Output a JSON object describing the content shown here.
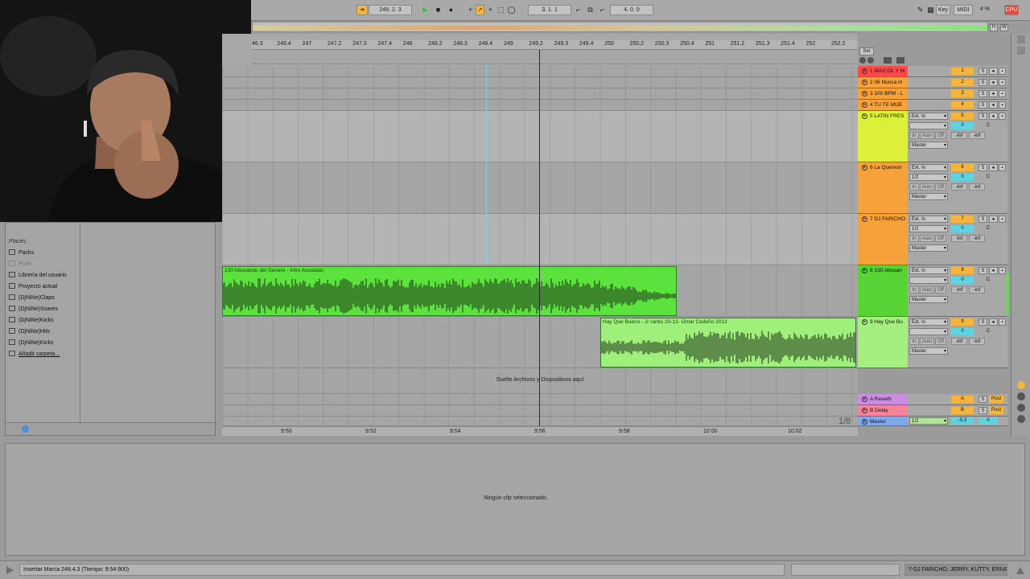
{
  "transport": {
    "follow_icon": "follow-arrow-icon",
    "song_position": "249.   2.   3",
    "loop_start": "3.   1.   1",
    "loop_length": "4.   0.   0"
  },
  "top_right": {
    "key_label": "Key",
    "midi_label": "MIDI",
    "cpu_percent": "4 %",
    "cpu_label": "CPU"
  },
  "ruler": {
    "bars": [
      "46.3",
      "246.4",
      "247",
      "247.2",
      "247.3",
      "247.4",
      "248",
      "248.2",
      "248.3",
      "248.4",
      "249",
      "249.2",
      "249.3",
      "249.4",
      "250",
      "250.2",
      "250.3",
      "250.4",
      "251",
      "251.2",
      "251.3",
      "251.4",
      "252",
      "252.2"
    ],
    "set_label": "Set"
  },
  "timeline": {
    "ticks": [
      "9:50",
      "9:52",
      "9:54",
      "9:56",
      "9:58",
      "10:00",
      "10:02"
    ],
    "quantize": "1/8"
  },
  "browser": {
    "places_header": "Places",
    "items": [
      {
        "label": "Packs",
        "icon": "packs-icon"
      },
      {
        "label": "Push",
        "icon": "push-icon"
      },
      {
        "label": "Librería del usuario",
        "icon": "folder-icon"
      },
      {
        "label": "Proyecto actual",
        "icon": "folder-icon"
      },
      {
        "label": "(DjNiNe)Claps",
        "icon": "folder-icon"
      },
      {
        "label": "(DjNiNe)Snares",
        "icon": "folder-icon"
      },
      {
        "label": "(DjNiNe)Kicks",
        "icon": "folder-icon"
      },
      {
        "label": "(DjNiNe)Hits",
        "icon": "folder-icon"
      },
      {
        "label": "(DjNiNe)Kicks",
        "icon": "folder-icon"
      },
      {
        "label": "Añadir carpeta...",
        "icon": "add-folder-icon"
      }
    ]
  },
  "tracks": [
    {
      "name": "1 MAICOL Y M",
      "color": "#ff4a4a",
      "num": "1"
    },
    {
      "name": "2 06 Nunca m",
      "color": "#f5a23a",
      "num": "2"
    },
    {
      "name": "3 100 BPM - L",
      "color": "#f5a23a",
      "num": "3"
    },
    {
      "name": "4 TU TE MUE",
      "color": "#f5a23a",
      "num": "4"
    },
    {
      "name": "5 LATIN FRES",
      "color": "#dcf038",
      "num": "5",
      "input": "Ext. In",
      "channel": "",
      "monitor": [
        "In",
        "Auto",
        "Off"
      ],
      "output": "Master",
      "vol": "-inf",
      "send": "-inf",
      "pan": "C",
      "zero": "0"
    },
    {
      "name": "6 La Quemon",
      "color": "#f5a23a",
      "num": "6",
      "input": "Ext. In",
      "channel": "1/2",
      "monitor": [
        "In",
        "Auto",
        "Off"
      ],
      "output": "Master",
      "vol": "-inf",
      "send": "-inf",
      "pan": "C",
      "zero": "0"
    },
    {
      "name": "7 DJ FARICHO",
      "color": "#f5a23a",
      "num": "7",
      "input": "Ext. In",
      "channel": "1/2",
      "monitor": [
        "In",
        "Auto",
        "Off"
      ],
      "output": "Master",
      "vol": "-inf",
      "send": "-inf",
      "pan": "C",
      "zero": "0"
    },
    {
      "name": "8 130 Abusan",
      "color": "#55d434",
      "num": "8",
      "input": "Ext. In",
      "channel": "",
      "monitor": [
        "In",
        "Auto",
        "Off"
      ],
      "output": "Master",
      "vol": "-inf",
      "send": "-inf",
      "pan": "C",
      "zero": "0"
    },
    {
      "name": "9 Hay Que Bu",
      "color": "#a4ef80",
      "num": "9",
      "input": "Ext. In",
      "channel": "",
      "monitor": [
        "In",
        "Auto",
        "Off"
      ],
      "output": "Master",
      "vol": "-inf",
      "send": "-inf",
      "pan": "C",
      "zero": "0"
    }
  ],
  "returns": [
    {
      "name": "A Reverb",
      "color": "#c98ee0",
      "num": "A",
      "post": "Post"
    },
    {
      "name": "B Delay",
      "color": "#f5849a",
      "num": "B",
      "post": "Post"
    },
    {
      "name": "Master",
      "color": "#7fa8e8",
      "num": "0",
      "channel": "1/2",
      "vol": "-5.3"
    }
  ],
  "clips": [
    {
      "title": "130 Abusando del Genero - Intro Asustado",
      "color": "#5ce23c"
    },
    {
      "title": "Hay Que Bueno - Jr ranks 20-13- Omar Cedeño 2013",
      "color": "#9ff07a"
    }
  ],
  "drop_hint": "Suelte Archivos y Dispositivos aquí",
  "detail_message": "Ningún clip seleccionado.",
  "status": {
    "message": "Insertar Marca 248.4.3 (Tiempo: 9:54:900)",
    "selected_tracks": "7-DJ FARICHO, JERRY, KUTTY, ERIVA..."
  }
}
